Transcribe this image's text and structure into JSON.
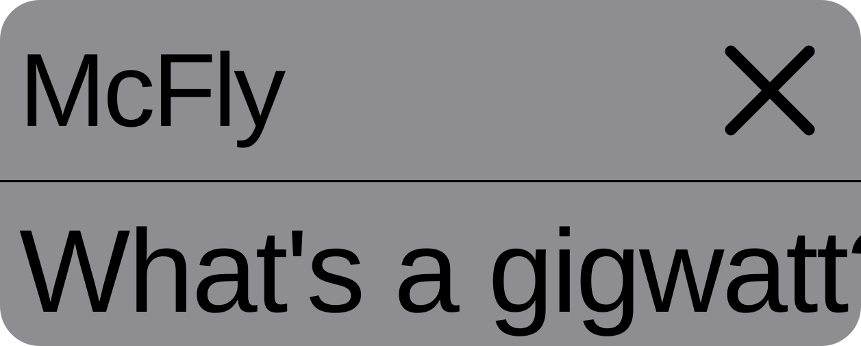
{
  "dialog": {
    "title": "McFly",
    "close_icon": "close-icon",
    "message": "What's a gigwatt?",
    "background_color": "#8e8d92",
    "text_color": "#000000"
  }
}
